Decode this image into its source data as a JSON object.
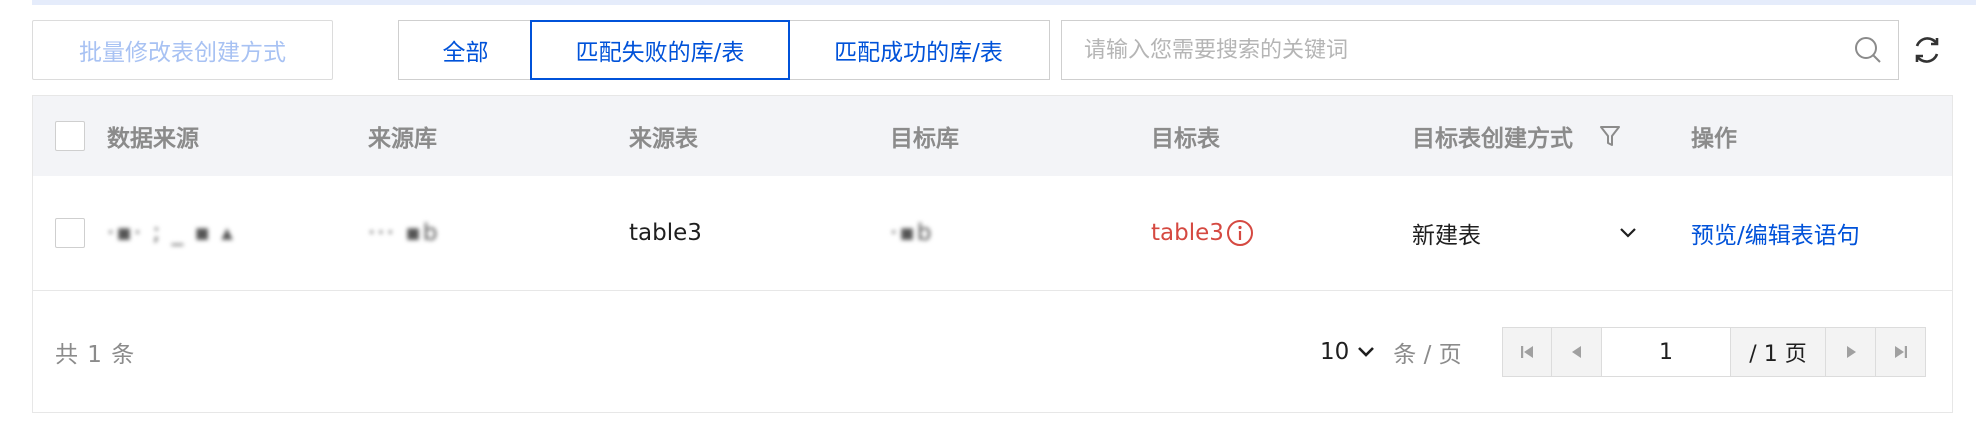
{
  "toolbar": {
    "batch_label": "批量修改表创建方式",
    "filters": [
      "全部",
      "匹配失败的库/表",
      "匹配成功的库/表"
    ],
    "active_filter": "匹配失败的库/表",
    "search_placeholder": "请输入您需要搜索的关键词",
    "search_icon": "search-icon",
    "refresh_icon": "refresh-icon"
  },
  "table": {
    "columns": [
      "数据来源",
      "来源库",
      "来源表",
      "目标库",
      "目标表",
      "目标表创建方式",
      "操作"
    ],
    "filter_icon": "filter-icon",
    "rows": [
      {
        "source": "·▪· ;  _  ▪ ▴",
        "source_db": "··· ▪b",
        "source_table": "table3",
        "target_db": "·▪b",
        "target_table": "table3",
        "create_mode": "新建表",
        "action": "预览/编辑表语句"
      }
    ]
  },
  "pagination": {
    "total_text": "共 1 条",
    "page_size": "10",
    "page_size_unit": "条 / 页",
    "current_page": "1",
    "total_pages_text": "/ 1 页"
  },
  "colors": {
    "primary": "#0052d9",
    "error": "#d54941",
    "header_bg": "#f3f4f7"
  }
}
